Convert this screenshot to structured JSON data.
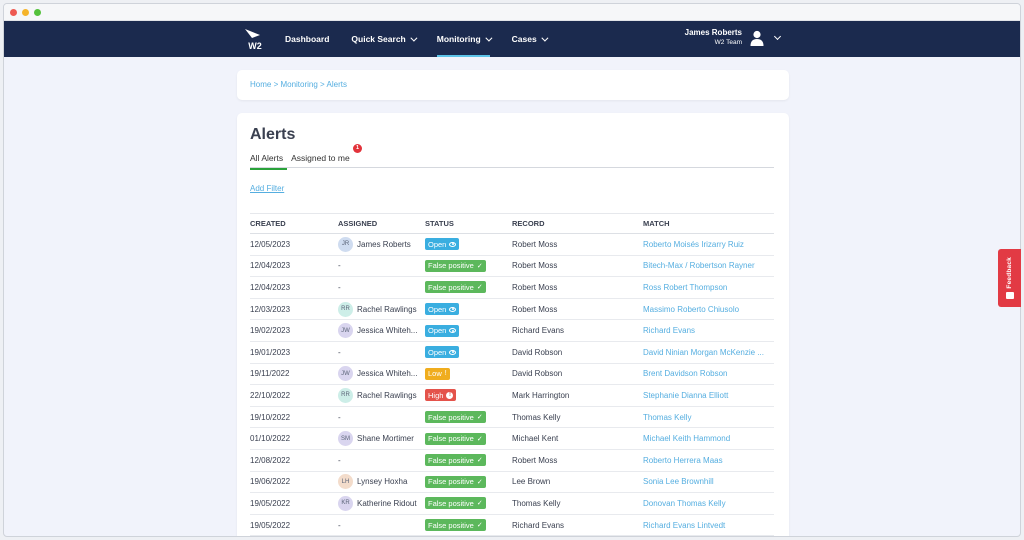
{
  "colors": {
    "nav_bg": "#1b2a4e",
    "accent": "#5cc3e8",
    "link": "#55aee0",
    "open": "#3aaee0",
    "false_positive": "#5cb85c",
    "low": "#f0ad1e",
    "high": "#e4534b",
    "feedback": "#e23a44"
  },
  "nav": {
    "logo_text": "W2",
    "links": [
      {
        "label": "Dashboard",
        "dropdown": false,
        "active": false
      },
      {
        "label": "Quick Search",
        "dropdown": true,
        "active": false
      },
      {
        "label": "Monitoring",
        "dropdown": true,
        "active": true
      },
      {
        "label": "Cases",
        "dropdown": true,
        "active": false
      }
    ],
    "user_name": "James Roberts",
    "user_team": "W2 Team"
  },
  "breadcrumb": {
    "home": "Home",
    "sep1": " > ",
    "monitoring": "Monitoring",
    "sep2": " > ",
    "alerts": "Alerts"
  },
  "page_title": "Alerts",
  "tabs": {
    "all": "All Alerts",
    "assigned": "Assigned to me",
    "assigned_badge": "1"
  },
  "add_filter": "Add Filter",
  "columns": [
    "CREATED",
    "ASSIGNED",
    "STATUS",
    "RECORD",
    "MATCH"
  ],
  "rows": [
    {
      "created": "12/05/2023",
      "initials": "JR",
      "assigned": "James Roberts",
      "avatar_color": "#cfdcf0",
      "status": "Open",
      "status_type": "open",
      "record": "Robert Moss",
      "match": "Roberto Moisés Irizarry Ruiz"
    },
    {
      "created": "12/04/2023",
      "initials": "",
      "assigned": "-",
      "avatar_color": "",
      "status": "False positive",
      "status_type": "fp",
      "record": "Robert Moss",
      "match": "Bitech-Max / Robertson Rayner"
    },
    {
      "created": "12/04/2023",
      "initials": "",
      "assigned": "-",
      "avatar_color": "",
      "status": "False positive",
      "status_type": "fp",
      "record": "Robert Moss",
      "match": "Ross Robert Thompson"
    },
    {
      "created": "12/03/2023",
      "initials": "RR",
      "assigned": "Rachel Rawlings",
      "avatar_color": "#cdeee8",
      "status": "Open",
      "status_type": "open",
      "record": "Robert Moss",
      "match": "Massimo Roberto Chiusolo"
    },
    {
      "created": "19/02/2023",
      "initials": "JW",
      "assigned": "Jessica Whiteh...",
      "avatar_color": "#d9d5ef",
      "status": "Open",
      "status_type": "open",
      "record": "Richard Evans",
      "match": "Richard Evans"
    },
    {
      "created": "19/01/2023",
      "initials": "",
      "assigned": "-",
      "avatar_color": "",
      "status": "Open",
      "status_type": "open",
      "record": "David Robson",
      "match": "David Ninian Morgan McKenzie ..."
    },
    {
      "created": "19/11/2022",
      "initials": "JW",
      "assigned": "Jessica Whiteh...",
      "avatar_color": "#d9d5ef",
      "status": "Low",
      "status_type": "low",
      "record": "David Robson",
      "match": "Brent Davidson Robson"
    },
    {
      "created": "22/10/2022",
      "initials": "RR",
      "assigned": "Rachel Rawlings",
      "avatar_color": "#cdeee8",
      "status": "High",
      "status_type": "high",
      "record": "Mark Harrington",
      "match": "Stephanie Dianna Elliott"
    },
    {
      "created": "19/10/2022",
      "initials": "",
      "assigned": "-",
      "avatar_color": "",
      "status": "False positive",
      "status_type": "fp",
      "record": "Thomas Kelly",
      "match": "Thomas Kelly"
    },
    {
      "created": "01/10/2022",
      "initials": "SM",
      "assigned": "Shane Mortimer",
      "avatar_color": "#d9d5ef",
      "status": "False positive",
      "status_type": "fp",
      "record": "Michael Kent",
      "match": "Michael Keith Hammond"
    },
    {
      "created": "12/08/2022",
      "initials": "",
      "assigned": "-",
      "avatar_color": "",
      "status": "False positive",
      "status_type": "fp",
      "record": "Robert Moss",
      "match": "Roberto Herrera Maas"
    },
    {
      "created": "19/06/2022",
      "initials": "LH",
      "assigned": "Lynsey Hoxha",
      "avatar_color": "#f3dccb",
      "status": "False positive",
      "status_type": "fp",
      "record": "Lee Brown",
      "match": "Sonia Lee Brownhill"
    },
    {
      "created": "19/05/2022",
      "initials": "KR",
      "assigned": "Katherine Ridout",
      "avatar_color": "#d9d5ef",
      "status": "False positive",
      "status_type": "fp",
      "record": "Thomas Kelly",
      "match": "Donovan Thomas Kelly"
    },
    {
      "created": "19/05/2022",
      "initials": "",
      "assigned": "-",
      "avatar_color": "",
      "status": "False positive",
      "status_type": "fp",
      "record": "Richard Evans",
      "match": "Richard Evans Lintvedt"
    },
    {
      "created": "19/05/2022",
      "initials": "",
      "assigned": "-",
      "avatar_color": "",
      "status": "False positive",
      "status_type": "fp",
      "record": "Richard Evans",
      "match": "Richard Evans-Freeman"
    }
  ],
  "feedback_label": "Feedback"
}
